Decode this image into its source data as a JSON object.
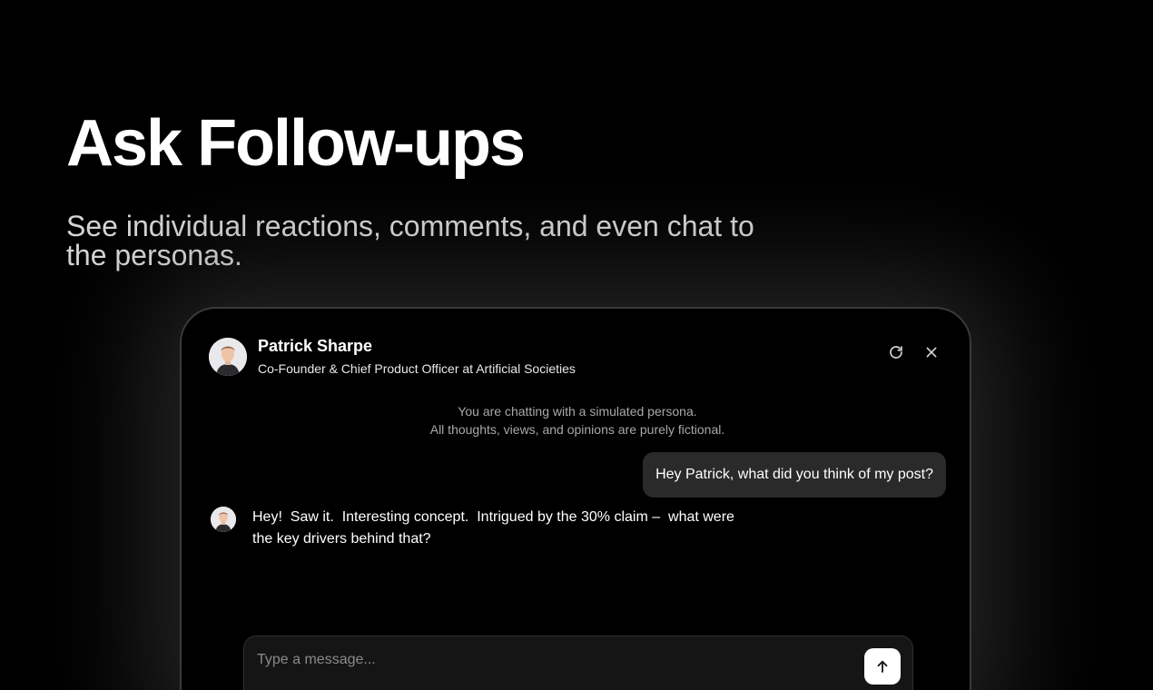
{
  "hero": {
    "title": "Ask Follow-ups",
    "subtitle": "See individual reactions, comments, and even chat to the personas."
  },
  "chat": {
    "persona": {
      "name": "Patrick Sharpe",
      "role": "Co-Founder & Chief Product Officer at Artificial Societies",
      "avatar_icon": "person-avatar-icon"
    },
    "actions": {
      "refresh_icon": "refresh-icon",
      "close_icon": "close-icon"
    },
    "disclaimer": {
      "line1": "You are chatting with a simulated persona.",
      "line2": "All thoughts, views, and opinions are purely fictional."
    },
    "messages": [
      {
        "sender": "user",
        "text": "Hey Patrick, what did you think of my post?"
      },
      {
        "sender": "persona",
        "text": "Hey!  Saw it.  Interesting concept.  Intrigued by the 30% claim –  what were the key drivers behind that?"
      }
    ],
    "composer": {
      "placeholder": "Type a message...",
      "value": "",
      "send_icon": "arrow-up-icon"
    }
  },
  "colors": {
    "background": "#000000",
    "user_bubble": "#2a2a2a",
    "muted_text": "#a8a8a8"
  }
}
